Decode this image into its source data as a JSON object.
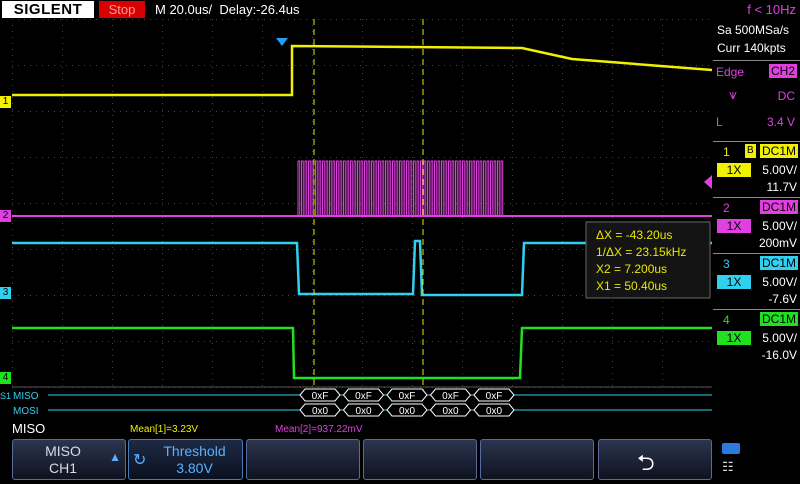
{
  "header": {
    "brand": "SIGLENT",
    "run_state": "Stop",
    "timebase": "M 20.0us/",
    "delay": "Delay:-26.4us",
    "trigger_freq": "f < 10Hz"
  },
  "acquisition": {
    "sample_rate": "Sa 500MSa/s",
    "memory_depth": "Curr 140kpts"
  },
  "trigger": {
    "type": "Edge",
    "source": "CH2",
    "coupling": "DC",
    "mode": "L",
    "level": "3.4 V"
  },
  "channels": [
    {
      "num": "1",
      "bw": "B",
      "coupling": "DC1M",
      "probe": "1X",
      "scale": "5.00V/",
      "offset": "11.7V",
      "color": "#f0f000"
    },
    {
      "num": "2",
      "coupling": "DC1M",
      "probe": "1X",
      "scale": "5.00V/",
      "offset": "200mV",
      "color": "#e040e0"
    },
    {
      "num": "3",
      "coupling": "DC1M",
      "probe": "1X",
      "scale": "5.00V/",
      "offset": "-7.6V",
      "color": "#30d0f0"
    },
    {
      "num": "4",
      "coupling": "DC1M",
      "probe": "1X",
      "scale": "5.00V/",
      "offset": "-16.0V",
      "color": "#20e020"
    }
  ],
  "cursors": {
    "delta_x": "ΔX = -43.20us",
    "inv_delta_x": "1/ΔX = 23.15kHz",
    "x2": "X2 = 7.200us",
    "x1": "X1 = 50.40us"
  },
  "decode": {
    "miso_label": "MISO",
    "mosi_label": "MOSI",
    "miso_values": [
      "0xF",
      "0xF",
      "0xF",
      "0xF",
      "0xF"
    ],
    "mosi_values": [
      "0x0",
      "0x0",
      "0x0",
      "0x0",
      "0x0"
    ]
  },
  "status": {
    "decode_channel": "MISO",
    "mean1": "Mean[1]=3.23V",
    "mean2": "Mean[2]=937.22mV"
  },
  "softkeys": {
    "miso_label": "MISO",
    "miso_value": "CH1",
    "threshold_label": "Threshold",
    "threshold_value": "3.80V"
  },
  "markers": {
    "ch1": "1",
    "ch2": "2",
    "ch3": "3",
    "ch4": "4",
    "bus": "S1"
  },
  "colors": {
    "ch1": "#f0f000",
    "ch2": "#e040e0",
    "ch3": "#30d0f0",
    "ch4": "#20e020",
    "cursor": "#e8e800",
    "grid": "#3a3a3a"
  }
}
